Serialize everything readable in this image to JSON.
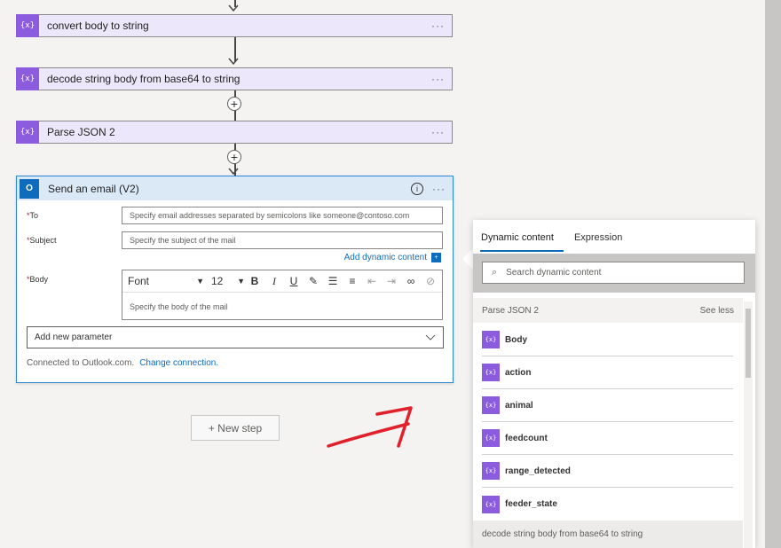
{
  "flow": {
    "actions": [
      {
        "title": "convert body to string",
        "icon": "variable-icon"
      },
      {
        "title": "decode string body from base64 to string",
        "icon": "variable-icon"
      },
      {
        "title": "Parse JSON 2",
        "icon": "variable-icon"
      }
    ],
    "more": "···",
    "plus": "+",
    "icon_glyph": "{x}"
  },
  "email": {
    "title": "Send an email (V2)",
    "icon_label": "O",
    "to_label": "To",
    "to_placeholder": "Specify email addresses separated by semicolons like someone@contoso.com",
    "subject_label": "Subject",
    "subject_placeholder": "Specify the subject of the mail",
    "add_dynamic": "Add dynamic content",
    "body_label": "Body",
    "font": "Font",
    "size": "12",
    "body_placeholder": "Specify the body of the mail",
    "add_param": "Add new parameter",
    "connected": "Connected to Outlook.com.",
    "change_conn": "Change connection.",
    "required": "*",
    "info": "i"
  },
  "new_step": "+ New step",
  "panel": {
    "tabs": [
      "Dynamic content",
      "Expression"
    ],
    "search_placeholder": "Search dynamic content",
    "group": "Parse JSON 2",
    "see_less": "See less",
    "items": [
      "Body",
      "action",
      "animal",
      "feedcount",
      "range_detected",
      "feeder_state"
    ],
    "next_group": "decode string body from base64 to string"
  },
  "colors": {
    "accent": "#0f6cbd",
    "variable": "#8c5cde",
    "annotation": "#e0202a"
  }
}
